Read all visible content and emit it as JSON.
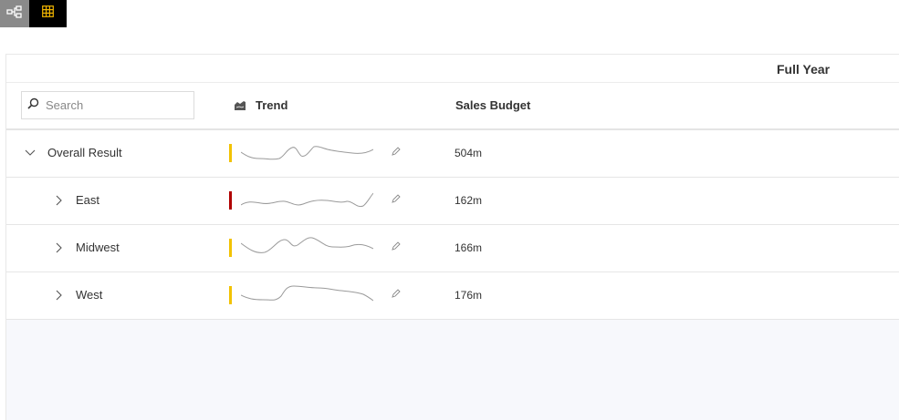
{
  "toolbar": {
    "hierarchy_icon": "hierarchy-icon",
    "table_icon": "table-grid-icon",
    "table_icon_color": "#f0b400"
  },
  "header": {
    "period": "Full Year",
    "search_placeholder": "Search",
    "trend_label": "Trend",
    "budget_label": "Sales Budget"
  },
  "colors": {
    "status_yellow": "#f2c200",
    "status_red": "#b00000",
    "spark_line": "#9a9a9a"
  },
  "rows": [
    {
      "label": "Overall Result",
      "value": "504m",
      "status": "yellow",
      "expanded": true,
      "level": 0
    },
    {
      "label": "East",
      "value": "162m",
      "status": "red",
      "expanded": false,
      "level": 1
    },
    {
      "label": "Midwest",
      "value": "166m",
      "status": "yellow",
      "expanded": false,
      "level": 1
    },
    {
      "label": "West",
      "value": "176m",
      "status": "yellow",
      "expanded": false,
      "level": 1
    }
  ]
}
